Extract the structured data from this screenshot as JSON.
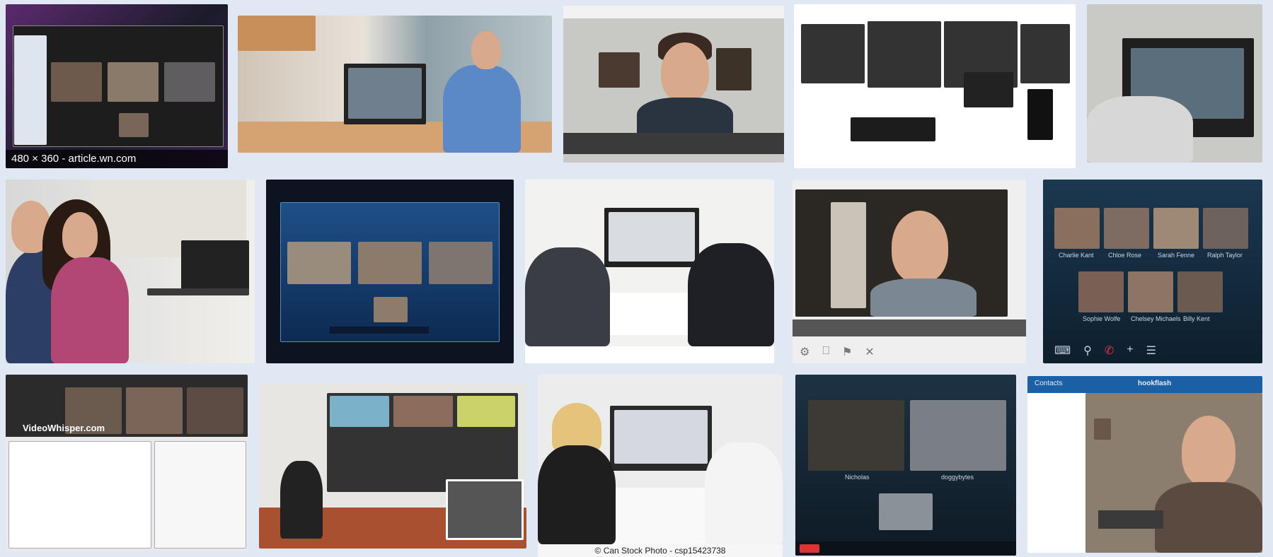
{
  "page": {
    "background": "#dfe8f3"
  },
  "tiles": {
    "t1": {
      "caption": "480 × 360 - article.wn.com"
    },
    "t10": {
      "names": [
        "Charlie Kant",
        "Chloe Rose",
        "Sarah Fenne",
        "Ralph Taylor",
        "Sophie Wolfe",
        "Chelsey Michaels",
        "Billy Kent"
      ]
    },
    "t11": {
      "watermark": "VideoWhisper.com"
    },
    "t13": {
      "credit": "© Can Stock Photo - csp15423738"
    },
    "t14": {
      "names": [
        "Nicholas",
        "doggybytes"
      ]
    },
    "t15": {
      "app_name": "hookflash",
      "tab": "Contacts"
    }
  },
  "colors": {
    "caption_bg": "#000000",
    "accent_blue": "#1b5fa5",
    "screen_glow": "#3a7bd5"
  }
}
